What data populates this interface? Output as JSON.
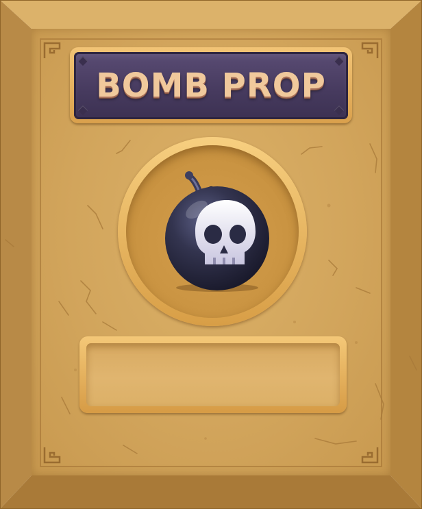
{
  "card": {
    "title": "BOMB PROP",
    "icon": "skull-bomb-icon",
    "description": ""
  },
  "colors": {
    "frame": "#c99a52",
    "plate": "#d6a95f",
    "banner": "#4a3d62",
    "title_text": "#f0c99c",
    "bomb_body": "#2d2e4a",
    "skull": "#e8e6f2"
  }
}
